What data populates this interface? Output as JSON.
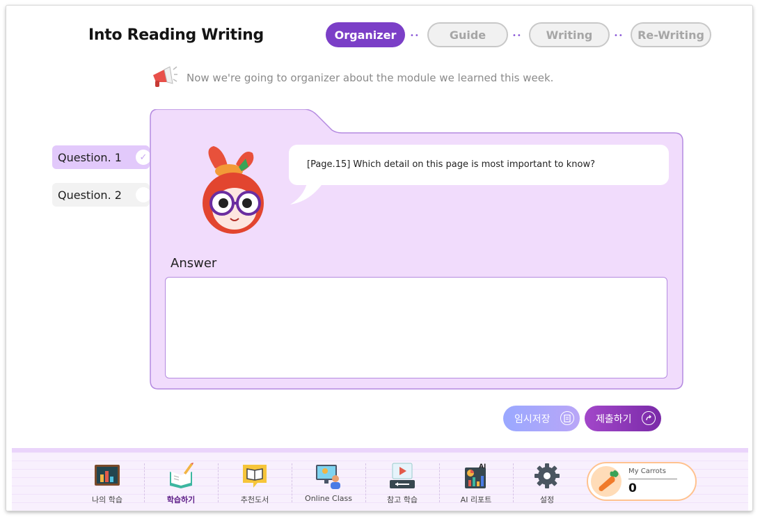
{
  "header": {
    "title": "Into Reading Writing",
    "steps": [
      {
        "label": "Organizer",
        "active": true
      },
      {
        "label": "Guide",
        "active": false
      },
      {
        "label": "Writing",
        "active": false
      },
      {
        "label": "Re-Writing",
        "active": false
      }
    ],
    "connector": "••"
  },
  "intro": {
    "icon": "megaphone-icon",
    "text": "Now we're going to organizer about the module we learned this week."
  },
  "questions": [
    {
      "label": "Question. 1",
      "selected": true,
      "done_mark": "✓"
    },
    {
      "label": "Question. 2",
      "selected": false,
      "done_mark": ""
    }
  ],
  "prompt": {
    "text": "[Page.15] Which detail on this page is most important to know?"
  },
  "answer": {
    "label": "Answer",
    "value": ""
  },
  "actions": {
    "save_label": "임시저장",
    "submit_label": "제출하기"
  },
  "bottom_nav": {
    "items": [
      {
        "label": "나의 학습",
        "icon": "chalkboard-icon",
        "active": false
      },
      {
        "label": "학습하기",
        "icon": "writing-book-icon",
        "active": true
      },
      {
        "label": "추천도서",
        "icon": "book-bubble-icon",
        "active": false
      },
      {
        "label": "Online Class",
        "icon": "online-class-icon",
        "active": false
      },
      {
        "label": "참고 학습",
        "icon": "video-lesson-icon",
        "active": false
      },
      {
        "label": "AI 리포트",
        "icon": "ai-report-icon",
        "active": false
      },
      {
        "label": "설정",
        "icon": "gear-icon",
        "active": false
      }
    ],
    "carrots": {
      "title": "My Carrots",
      "count": "0"
    }
  },
  "colors": {
    "accent": "#7b3fc7",
    "panel": "#f1dcfc",
    "panel_border": "#b48ae0",
    "submit": "#8a34b8",
    "save": "#a9a6fb"
  }
}
